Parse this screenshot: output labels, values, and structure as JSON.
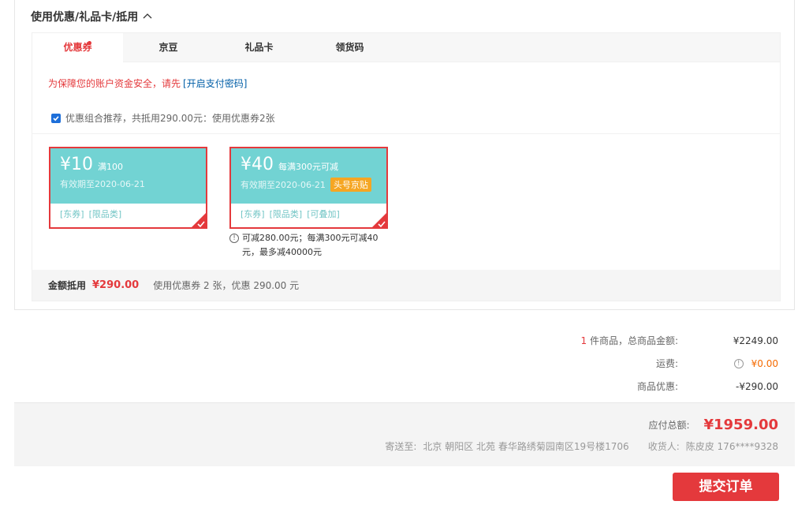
{
  "section": {
    "title": "使用优惠/礼品卡/抵用",
    "tabs": [
      "优惠券",
      "京豆",
      "礼品卡",
      "领货码"
    ],
    "warning_text": "为保障您的账户资金安全，请先",
    "warning_link": "[开启支付密码]",
    "combo_text": "优惠组合推荐，共抵用290.00元：使用优惠券2张",
    "coupons": [
      {
        "amount": "¥10",
        "condition": "满100",
        "expiry": "有效期至2020-06-21",
        "badge": "",
        "tags": [
          "[东券]",
          "[限品类]"
        ]
      },
      {
        "amount": "¥40",
        "condition": "每满300元可减",
        "expiry": "有效期至2020-06-21",
        "badge": "头号京贴",
        "tags": [
          "[东券]",
          "[限品类]",
          "[可叠加]"
        ]
      }
    ],
    "coupon_note": "可减280.00元；每满300元可减40元，最多减40000元",
    "summary_label": "金额抵用",
    "summary_value": "¥290.00",
    "summary_desc": "使用优惠券 2 张，优惠 290.00 元"
  },
  "totals": {
    "items_count": "1",
    "items_label": "件商品，总商品金额:",
    "items_value": "¥2249.00",
    "shipping_label": "运费:",
    "shipping_value": "¥0.00",
    "discount_label": "商品优惠:",
    "discount_value": "-¥290.00"
  },
  "payment": {
    "total_label": "应付总额:",
    "total_value": "¥1959.00",
    "address_label": "寄送至:",
    "address": "北京 朝阳区 北苑 春华路绣菊园南区19号楼1706",
    "receiver_label": "收货人:",
    "receiver": "陈皮皮 176****9328"
  },
  "submit_label": "提交订单",
  "colors": {
    "accent": "#e4393c",
    "coupon_bg": "#72d3d3",
    "badge": "#f5a623",
    "link": "#005ea7"
  }
}
